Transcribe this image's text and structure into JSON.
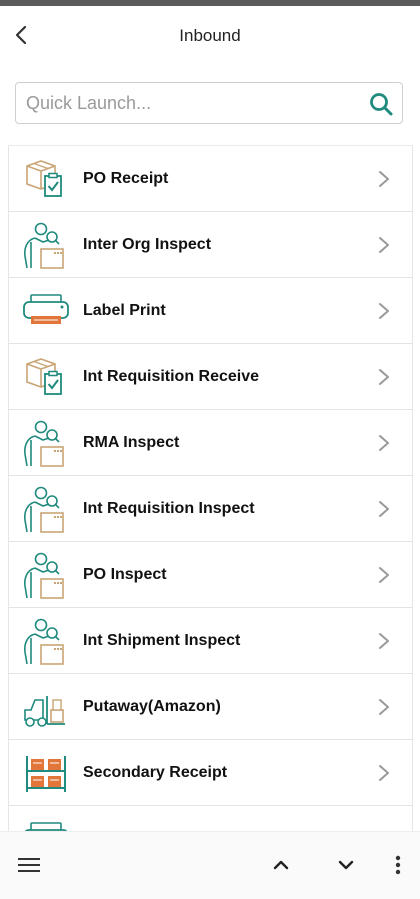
{
  "header": {
    "title": "Inbound"
  },
  "search": {
    "placeholder": "Quick Launch..."
  },
  "items": [
    {
      "label": "PO Receipt",
      "icon": "box-checklist-icon"
    },
    {
      "label": "Inter Org Inspect",
      "icon": "inspector-icon"
    },
    {
      "label": "Label Print",
      "icon": "printer-icon"
    },
    {
      "label": "Int Requisition Receive",
      "icon": "box-checklist-icon"
    },
    {
      "label": "RMA Inspect",
      "icon": "inspector-icon"
    },
    {
      "label": "Int Requisition Inspect",
      "icon": "inspector-icon"
    },
    {
      "label": "PO Inspect",
      "icon": "inspector-icon"
    },
    {
      "label": "Int Shipment Inspect",
      "icon": "inspector-icon"
    },
    {
      "label": "Putaway(Amazon)",
      "icon": "forklift-icon"
    },
    {
      "label": "Secondary Receipt",
      "icon": "shelves-icon"
    },
    {
      "label": "",
      "icon": "printer-icon"
    }
  ],
  "colors": {
    "teal": "#1f8a7d",
    "orange": "#e2753a",
    "tan": "#c9a576",
    "text": "#111111"
  }
}
